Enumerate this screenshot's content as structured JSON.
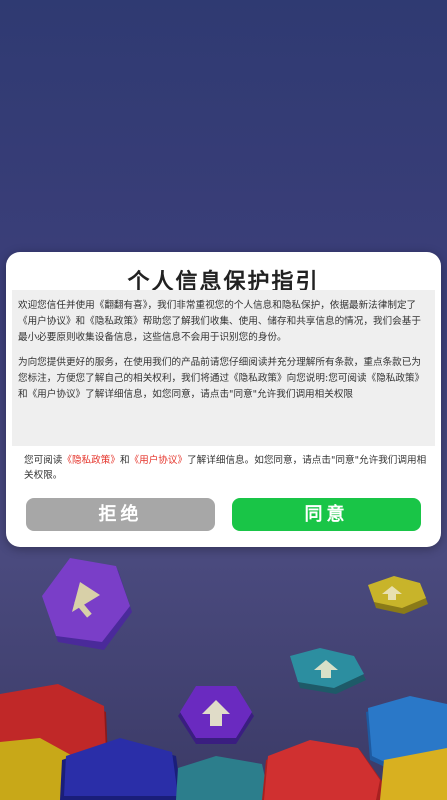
{
  "dialog": {
    "title": "个人信息保护指引",
    "paragraph1": "欢迎您信任并使用《翻翻有喜》，我们非常重视您的个人信息和隐私保护，依据最新法律制定了《用户协议》和《隐私政策》帮助您了解我们收集、使用、储存和共享信息的情况，我们会基于最小必要原则收集设备信息，这些信息不会用于识别您的身份。",
    "paragraph2": "为向您提供更好的服务，在使用我们的产品前请您仔细阅读并充分理解所有条款，重点条款已为您标注，方便您了解自己的相关权利，我们将通过《隐私政策》向您说明:您可阅读《隐私政策》和《用户协议》了解详细信息，如您同意，请点击\"同意\"允许我们调用相关权限",
    "notice_prefix": "您可阅读",
    "privacy_link": "《隐私政策》",
    "notice_and": "和",
    "user_agreement_link": "《用户协议》",
    "notice_suffix": "了解详细信息。如您同意，请点击\"同意\"允许我们调用相关权限。",
    "refuse_label": "拒绝",
    "agree_label": "同意"
  },
  "colors": {
    "link": "#e5332a",
    "agree_button": "#19c547",
    "refuse_button": "#a7a7a7"
  },
  "background": {
    "tiles": [
      "up-arrow-icon",
      "up-arrow-icon",
      "up-arrow-icon",
      "up-arrow-icon",
      "up-arrow-icon"
    ]
  }
}
